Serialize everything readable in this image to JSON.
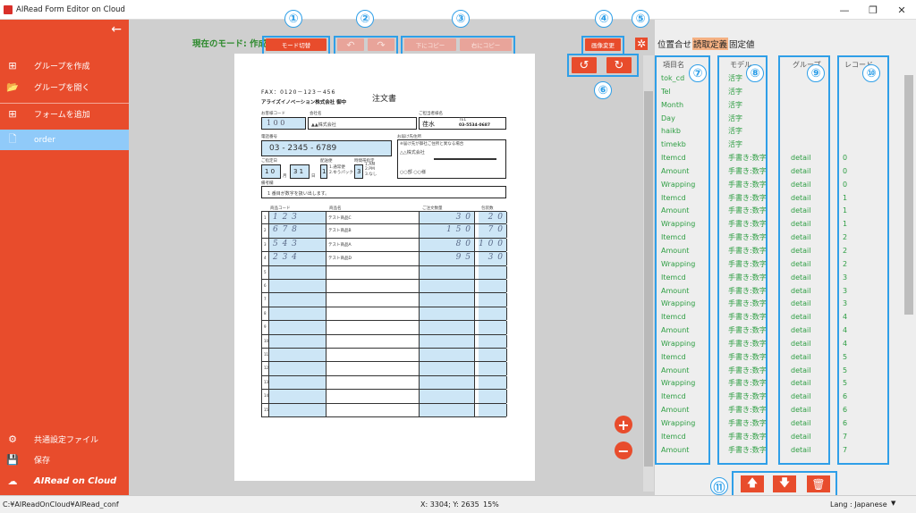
{
  "window": {
    "title": "AIRead Form Editor on Cloud",
    "minimize": "—",
    "restore": "❐",
    "close": "✕"
  },
  "sidebar": {
    "back_icon": "←",
    "items": [
      {
        "label": "グループを作成",
        "icon": "⊞"
      },
      {
        "label": "グループを開く",
        "icon": "📂"
      },
      {
        "label": "フォームを追加",
        "icon": "⊞"
      },
      {
        "label": "order",
        "icon": "🗋"
      }
    ],
    "bottom_items": [
      {
        "label": "共通設定ファイル",
        "icon": "⚙"
      },
      {
        "label": "保存",
        "icon": "💾"
      }
    ],
    "logo": "AIRead on Cloud"
  },
  "toolbar": {
    "mode_label": "現在のモード: 作成",
    "mode_switch": "モード切替",
    "undo_icon": "↶",
    "redo_icon": "↷",
    "copy_left": "下にコピー",
    "copy_right": "右にコピー",
    "image_change": "画像変更",
    "gear_icon": "✲",
    "rotate_left_icon": "↺",
    "rotate_right_icon": "↻",
    "zoom_in_icon": "+",
    "zoom_out_icon": "−"
  },
  "callouts": [
    "①",
    "②",
    "③",
    "④",
    "⑤",
    "⑥",
    "⑦",
    "⑧",
    "⑨",
    "⑩",
    "⑪"
  ],
  "form": {
    "fax": "FAX：0120－123－456",
    "company": "アライズイノベーション株式会社 御中",
    "title": "注文書",
    "customer_code_label": "お客様コード",
    "customer_code": "1 0 0",
    "company_name_label": "会社名",
    "company_name": "▲▲株式会社",
    "person_label": "ご担当者様名",
    "person": "荏水",
    "tel_label": "TEL",
    "tel": "03-5534-0687",
    "phone_label": "電話番号",
    "phone": "03 - 2345 - 6789",
    "delivery_label": "お届け先住所",
    "delivery_note": "※届け先が御社ご住所と異なる場合",
    "delivery_company": "△△株式会社",
    "delivery_dept": "○○部 ○○様",
    "date_label": "ご指定日",
    "month": "1 0",
    "day": "3 1",
    "month_unit": "月",
    "day_unit": "日",
    "opt_label": "配送便",
    "opt_num": "1",
    "opt_list": "1.通常便\n2.ゆうパック",
    "time_label": "時間帯指定",
    "time_num": "3",
    "time_list": "1.AM\n2.PM\n3.なし",
    "note_label": "備考欄",
    "note": "1 番目が数字を扱い出します。",
    "col_code": "商品コード",
    "col_name": "商品名",
    "col_qty": "ご注文数量",
    "col_wrap": "包装数",
    "lines": [
      {
        "n": "1",
        "code": "1 2 3",
        "name": "テスト商品C",
        "qty": "3 0",
        "wrap": "2 0"
      },
      {
        "n": "2",
        "code": "6 7 8",
        "name": "テスト商品B",
        "qty": "1 5 0",
        "wrap": "7 0"
      },
      {
        "n": "3",
        "code": "5 4 3",
        "name": "テスト商品A",
        "qty": "8 0",
        "wrap": "1 0 0"
      },
      {
        "n": "4",
        "code": "2 3 4",
        "name": "テスト商品D",
        "qty": "9 5",
        "wrap": "3 0"
      },
      {
        "n": "5"
      },
      {
        "n": "6"
      },
      {
        "n": "7"
      },
      {
        "n": "8"
      },
      {
        "n": "9"
      },
      {
        "n": "10"
      },
      {
        "n": "11"
      },
      {
        "n": "12"
      },
      {
        "n": "13"
      },
      {
        "n": "14"
      },
      {
        "n": "15"
      }
    ]
  },
  "right_panel": {
    "tabs": [
      "位置合せ",
      "読取定義",
      "固定値"
    ],
    "active_tab": "読取定義",
    "headers": {
      "name": "項目名",
      "model": "モデル",
      "group": "グループ",
      "record": "レコード"
    },
    "rows": [
      {
        "name": "tok_cd",
        "model": "活字",
        "group": "",
        "record": ""
      },
      {
        "name": "Tel",
        "model": "活字",
        "group": "",
        "record": ""
      },
      {
        "name": "Month",
        "model": "活字",
        "group": "",
        "record": ""
      },
      {
        "name": "Day",
        "model": "活字",
        "group": "",
        "record": ""
      },
      {
        "name": "haikb",
        "model": "活字",
        "group": "",
        "record": ""
      },
      {
        "name": "timekb",
        "model": "活字",
        "group": "",
        "record": ""
      },
      {
        "name": "Itemcd",
        "model": "手書き:数字",
        "group": "detail",
        "record": "0"
      },
      {
        "name": "Amount",
        "model": "手書き:数字",
        "group": "detail",
        "record": "0"
      },
      {
        "name": "Wrapping",
        "model": "手書き:数字",
        "group": "detail",
        "record": "0"
      },
      {
        "name": "Itemcd",
        "model": "手書き:数字",
        "group": "detail",
        "record": "1"
      },
      {
        "name": "Amount",
        "model": "手書き:数字",
        "group": "detail",
        "record": "1"
      },
      {
        "name": "Wrapping",
        "model": "手書き:数字",
        "group": "detail",
        "record": "1"
      },
      {
        "name": "Itemcd",
        "model": "手書き:数字",
        "group": "detail",
        "record": "2"
      },
      {
        "name": "Amount",
        "model": "手書き:数字",
        "group": "detail",
        "record": "2"
      },
      {
        "name": "Wrapping",
        "model": "手書き:数字",
        "group": "detail",
        "record": "2"
      },
      {
        "name": "Itemcd",
        "model": "手書き:数字",
        "group": "detail",
        "record": "3"
      },
      {
        "name": "Amount",
        "model": "手書き:数字",
        "group": "detail",
        "record": "3"
      },
      {
        "name": "Wrapping",
        "model": "手書き:数字",
        "group": "detail",
        "record": "3"
      },
      {
        "name": "Itemcd",
        "model": "手書き:数字",
        "group": "detail",
        "record": "4"
      },
      {
        "name": "Amount",
        "model": "手書き:数字",
        "group": "detail",
        "record": "4"
      },
      {
        "name": "Wrapping",
        "model": "手書き:数字",
        "group": "detail",
        "record": "4"
      },
      {
        "name": "Itemcd",
        "model": "手書き:数字",
        "group": "detail",
        "record": "5"
      },
      {
        "name": "Amount",
        "model": "手書き:数字",
        "group": "detail",
        "record": "5"
      },
      {
        "name": "Wrapping",
        "model": "手書き:数字",
        "group": "detail",
        "record": "5"
      },
      {
        "name": "Itemcd",
        "model": "手書き:数字",
        "group": "detail",
        "record": "6"
      },
      {
        "name": "Amount",
        "model": "手書き:数字",
        "group": "detail",
        "record": "6"
      },
      {
        "name": "Wrapping",
        "model": "手書き:数字",
        "group": "detail",
        "record": "6"
      },
      {
        "name": "Itemcd",
        "model": "手書き:数字",
        "group": "detail",
        "record": "7"
      },
      {
        "name": "Amount",
        "model": "手書き:数字",
        "group": "detail",
        "record": "7"
      }
    ],
    "up_icon": "🡅",
    "down_icon": "🡇",
    "delete_icon": "🗑"
  },
  "status": {
    "path": "C:¥AIReadOnCloud¥AIRead_conf",
    "coords": "X: 3304; Y: 2635",
    "zoom": "15%",
    "lang": "Lang : Japanese"
  },
  "colors": {
    "accent": "#e84c2c",
    "highlight": "#2f9fe8",
    "row_text": "#2e9e43",
    "active_item": "#90caf9",
    "tab_active": "#f5b183"
  }
}
